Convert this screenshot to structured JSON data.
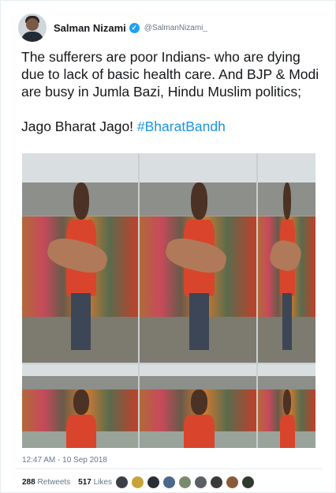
{
  "user": {
    "name": "Salman Nizami",
    "handle": "@SalmanNizami_"
  },
  "tweet": {
    "line1": "The sufferers are poor Indians- who are dying due to lack of basic health care. And BJP & Modi are busy in Jumla Bazi, Hindu Muslim politics;",
    "line2_text": "Jago Bharat Jago! ",
    "hashtag": "#BharatBandh",
    "timestamp": "12:47 AM - 10 Sep 2018"
  },
  "stats": {
    "retweets_count": "288",
    "retweets_label": "Retweets",
    "likes_count": "517",
    "likes_label": "Likes"
  },
  "likers": [
    "#3b3f46",
    "#c9a23a",
    "#2a2f36",
    "#4a6a8a",
    "#7a8a6a",
    "#5a5f66",
    "#3a3a3a",
    "#8a5a3a",
    "#2e3a2e"
  ],
  "colors": {
    "link": "#1b95e0",
    "verified": "#1da1f2",
    "muted": "#657786"
  }
}
